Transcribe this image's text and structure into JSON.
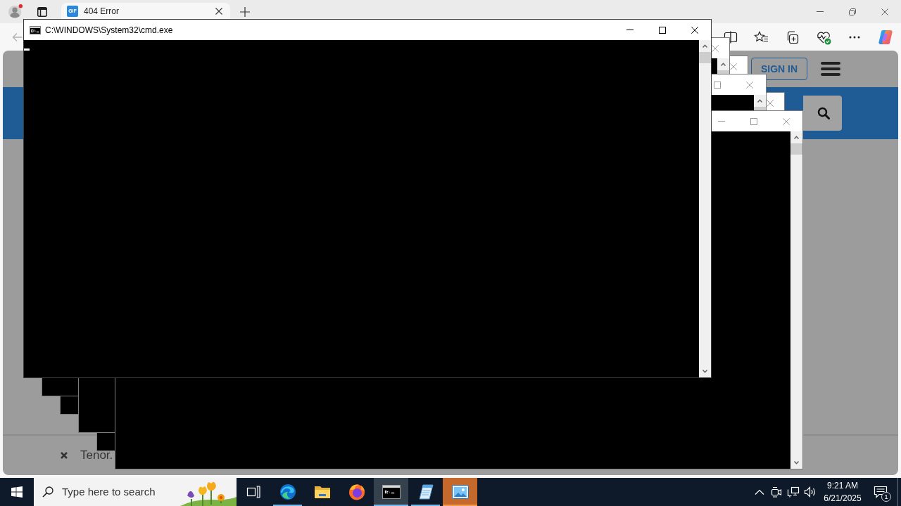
{
  "browser": {
    "tabs": [
      {
        "title": "404 Error",
        "favicon": "GIF",
        "selected": true
      }
    ]
  },
  "webpage": {
    "sign_in": "SIGN IN",
    "footer_text": "Tenor."
  },
  "console_windows": [
    {
      "title": "C:\\WINDOWS\\System32\\cmd.exe",
      "active": true,
      "cursor": true,
      "buttons": [
        {
          "kind": "minimize"
        },
        {
          "kind": "maximize"
        },
        {
          "kind": "close"
        }
      ]
    },
    {
      "active": false,
      "buttons": [
        {
          "kind": "close"
        }
      ]
    },
    {
      "active": false,
      "buttons": [
        {
          "kind": "close"
        }
      ]
    },
    {
      "active": false,
      "buttons": [
        {
          "kind": "maximize"
        },
        {
          "kind": "close"
        }
      ]
    },
    {
      "active": false,
      "buttons": [
        {
          "kind": "close"
        }
      ]
    },
    {
      "active": false,
      "buttons": [
        {
          "kind": "minimize"
        },
        {
          "kind": "maximize"
        },
        {
          "kind": "close"
        }
      ]
    }
  ],
  "taskbar": {
    "search": {
      "placeholder": "Type here to search"
    },
    "apps": [
      {
        "kind": "edge",
        "running": true,
        "selected": false,
        "flashing": false
      },
      {
        "kind": "explorer",
        "running": false,
        "selected": false,
        "flashing": false
      },
      {
        "kind": "firefox",
        "running": false,
        "selected": false,
        "flashing": false
      },
      {
        "kind": "terminal",
        "running": true,
        "selected": true,
        "flashing": false
      },
      {
        "kind": "notepad",
        "running": true,
        "selected": false,
        "flashing": false
      },
      {
        "kind": "photos",
        "running": true,
        "selected": false,
        "flashing": true
      }
    ],
    "clock": {
      "time": "9:21 AM",
      "date": "6/21/2025"
    },
    "notifications": "1"
  }
}
